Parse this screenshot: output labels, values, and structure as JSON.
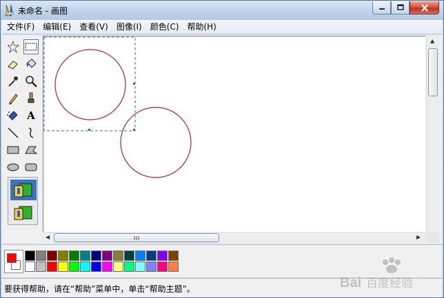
{
  "window": {
    "title": "未命名 - 画图",
    "buttons": [
      "minimize",
      "maximize",
      "close"
    ]
  },
  "menu": [
    "文件(F)",
    "编辑(E)",
    "查看(V)",
    "图像(I)",
    "颜色(C)",
    "帮助(H)"
  ],
  "tools": [
    {
      "name": "free-select",
      "icon": "star-select-icon"
    },
    {
      "name": "rect-select",
      "icon": "rect-select-icon",
      "selected": true
    },
    {
      "name": "eraser",
      "icon": "eraser-icon"
    },
    {
      "name": "fill",
      "icon": "fill-bucket-icon"
    },
    {
      "name": "color-picker",
      "icon": "eyedropper-icon"
    },
    {
      "name": "magnifier",
      "icon": "magnifier-icon"
    },
    {
      "name": "pencil",
      "icon": "pencil-icon"
    },
    {
      "name": "brush",
      "icon": "brush-icon"
    },
    {
      "name": "airbrush",
      "icon": "airbrush-icon"
    },
    {
      "name": "text",
      "icon": "text-icon",
      "glyph": "A"
    },
    {
      "name": "line",
      "icon": "line-icon"
    },
    {
      "name": "curve",
      "icon": "curve-icon"
    },
    {
      "name": "rectangle",
      "icon": "rectangle-icon"
    },
    {
      "name": "polygon",
      "icon": "polygon-icon"
    },
    {
      "name": "ellipse",
      "icon": "ellipse-icon"
    },
    {
      "name": "rounded-rect",
      "icon": "rounded-rect-icon"
    }
  ],
  "tool_options": [
    "opaque-background",
    "transparent-background"
  ],
  "canvas": {
    "shapes": [
      "circle",
      "circle"
    ],
    "stroke_color": "#a52a2a",
    "selection": true
  },
  "colors": {
    "foreground": "#ff0000",
    "background": "#ffffff",
    "palette_row1": [
      "#000000",
      "#808080",
      "#800000",
      "#808000",
      "#008000",
      "#008080",
      "#000080",
      "#800080",
      "#808040",
      "#004040",
      "#0080ff",
      "#004080",
      "#8000ff",
      "#804000"
    ],
    "palette_row2": [
      "#ffffff",
      "#c0c0c0",
      "#ff0000",
      "#ffff00",
      "#00ff00",
      "#00ffff",
      "#0000ff",
      "#ff00ff",
      "#ffff80",
      "#00ff80",
      "#80ffff",
      "#8080ff",
      "#ff0080",
      "#ff8040"
    ]
  },
  "status": {
    "text": "要获得帮助，请在“帮助”菜单中，单击“帮助主题”。"
  },
  "watermark": {
    "text": "Bai百度经验"
  }
}
